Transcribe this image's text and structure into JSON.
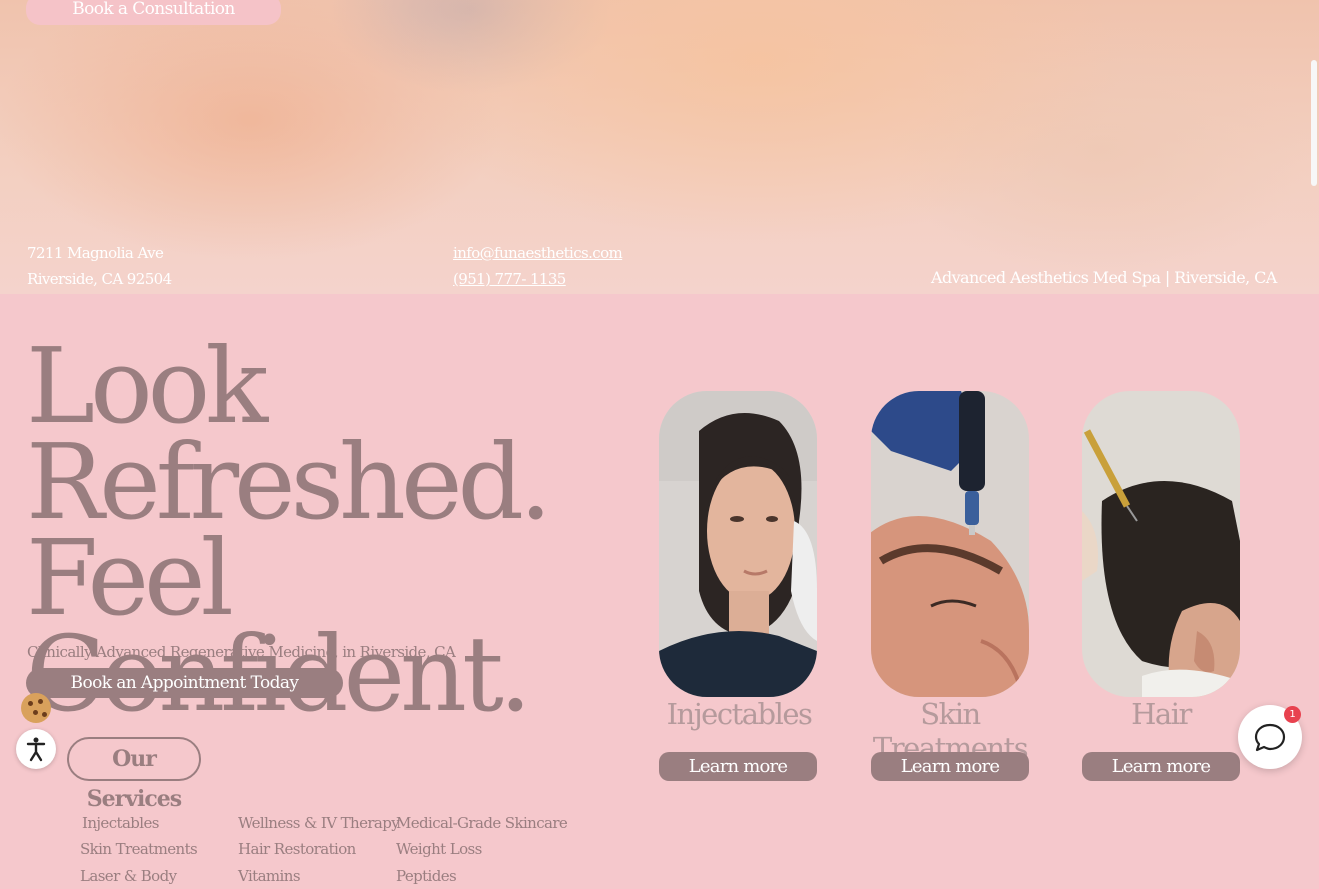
{
  "hero": {
    "book_consultation": "Book a Consultation",
    "address_line1": "7211 Magnolia Ave",
    "address_line2": "Riverside, CA 92504",
    "email": "info@funaesthetics.com",
    "phone": "(951) 777- 1135",
    "tagline": "Advanced Aesthetics Med Spa | Riverside, CA"
  },
  "main": {
    "headline": "Look Refreshed. Feel Confident.",
    "subline": "Clinically Advanced Regenerative Medicine, in Riverside, CA",
    "cta": "Book an Appointment Today",
    "services_heading": "Our Services",
    "service_links": [
      "Injectables",
      "Skin Treatments",
      "Laser & Body",
      "Wellness & IV Therapy",
      "Hair Restoration",
      "Vitamins",
      "Medical-Grade Skincare",
      "Weight Loss",
      "Peptides"
    ]
  },
  "cards": [
    {
      "title": "Injectables",
      "button": "Learn more"
    },
    {
      "title": "Skin Treatments",
      "button": "Learn more"
    },
    {
      "title": "Hair",
      "button": "Learn more"
    }
  ],
  "widgets": {
    "chat_badge": "1"
  }
}
